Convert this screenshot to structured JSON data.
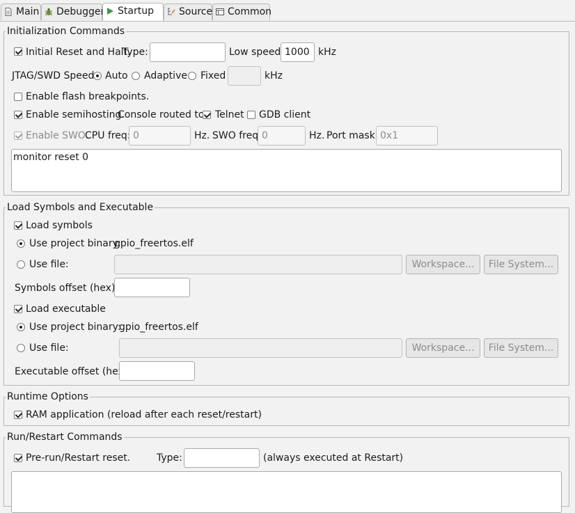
{
  "tabs": [
    {
      "label": "Main",
      "icon": "document-icon"
    },
    {
      "label": "Debugger",
      "icon": "bug-icon"
    },
    {
      "label": "Startup",
      "icon": "run-icon"
    },
    {
      "label": "Source",
      "icon": "source-icon"
    },
    {
      "label": "Common",
      "icon": "common-icon"
    }
  ],
  "init": {
    "title": "Initialization Commands",
    "initial_reset_label": "Initial Reset and Halt.",
    "initial_reset_checked": true,
    "type_label": "Type:",
    "type_value": "",
    "low_speed_label": "Low speed:",
    "low_speed_value": "1000",
    "khz": "kHz",
    "jtag_label": "JTAG/SWD Speed:",
    "auto_label": "Auto",
    "adaptive_label": "Adaptive",
    "fixed_label": "Fixed",
    "fixed_value": "",
    "selected_speed": "Auto",
    "flash_bp_label": "Enable flash breakpoints.",
    "flash_bp_checked": false,
    "semihosting_label": "Enable semihosting.",
    "semihosting_checked": true,
    "console_label": "Console routed to:",
    "telnet_label": "Telnet",
    "telnet_checked": true,
    "gdb_client_label": "GDB client",
    "gdb_client_checked": false,
    "swo_label": "Enable SWO.",
    "swo_checked": true,
    "cpu_freq_label": "CPU freq:",
    "cpu_freq_value": "0",
    "hz": "Hz.",
    "swo_freq_label": "SWO freq:",
    "swo_freq_value": "0",
    "port_mask_label": "Port mask:",
    "port_mask_value": "0x1",
    "commands": "monitor reset 0"
  },
  "load": {
    "title": "Load Symbols and Executable",
    "load_symbols_label": "Load symbols",
    "load_symbols_checked": true,
    "use_project_binary_label": "Use project binary:",
    "symbols_binary": "gpio_freertos.elf",
    "use_file_label": "Use file:",
    "symbols_file_value": "",
    "workspace_label": "Workspace...",
    "file_system_label": "File System...",
    "symbols_offset_label": "Symbols offset (hex):",
    "symbols_offset_value": "",
    "load_exec_label": "Load executable",
    "load_exec_checked": true,
    "exec_binary": "gpio_freertos.elf",
    "exec_file_value": "",
    "exec_offset_label": "Executable offset (hex):",
    "exec_offset_value": ""
  },
  "runtime": {
    "title": "Runtime Options",
    "ram_app_label": "RAM application (reload after each reset/restart)",
    "ram_app_checked": true
  },
  "run": {
    "title": "Run/Restart Commands",
    "prerun_label": "Pre-run/Restart reset.",
    "prerun_checked": true,
    "type_label": "Type:",
    "type_value": "",
    "always_label": "(always executed at Restart)",
    "commands": ""
  }
}
